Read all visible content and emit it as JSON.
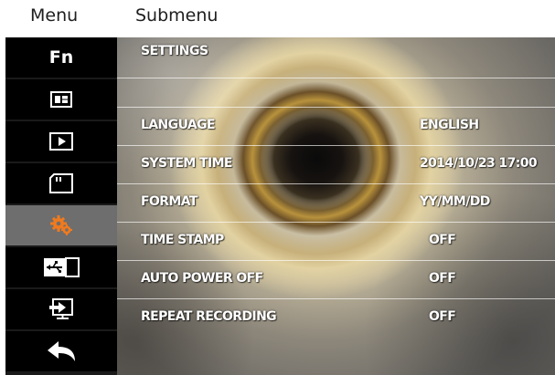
{
  "header": {
    "menu_label": "Menu",
    "submenu_label": "Submenu"
  },
  "menu": {
    "items": [
      {
        "name": "fn",
        "label": "Fn",
        "icon": "fn-text"
      },
      {
        "name": "photo-grid",
        "icon": "grid-icon"
      },
      {
        "name": "playback",
        "icon": "play-icon"
      },
      {
        "name": "memory-card",
        "icon": "sd-card-icon"
      },
      {
        "name": "settings",
        "icon": "gear-icon",
        "selected": true
      },
      {
        "name": "usb-connect",
        "icon": "usb-icon"
      },
      {
        "name": "input-source",
        "icon": "input-icon"
      },
      {
        "name": "back",
        "icon": "back-arrow-icon"
      }
    ]
  },
  "settings": {
    "title": "SETTINGS",
    "rows": [
      {
        "label": "LANGUAGE",
        "value": "ENGLISH"
      },
      {
        "label": "SYSTEM TIME",
        "value": "2014/10/23 17:00"
      },
      {
        "label": "FORMAT",
        "value": "YY/MM/DD"
      },
      {
        "label": "TIME STAMP",
        "value": "OFF"
      },
      {
        "label": "AUTO POWER OFF",
        "value": "OFF"
      },
      {
        "label": "REPEAT RECORDING",
        "value": "OFF"
      }
    ]
  },
  "colors": {
    "menu_bg": "#000000",
    "selected_bg": "#6e6e6e",
    "accent_orange": "#f07a1e",
    "text": "#ffffff"
  }
}
